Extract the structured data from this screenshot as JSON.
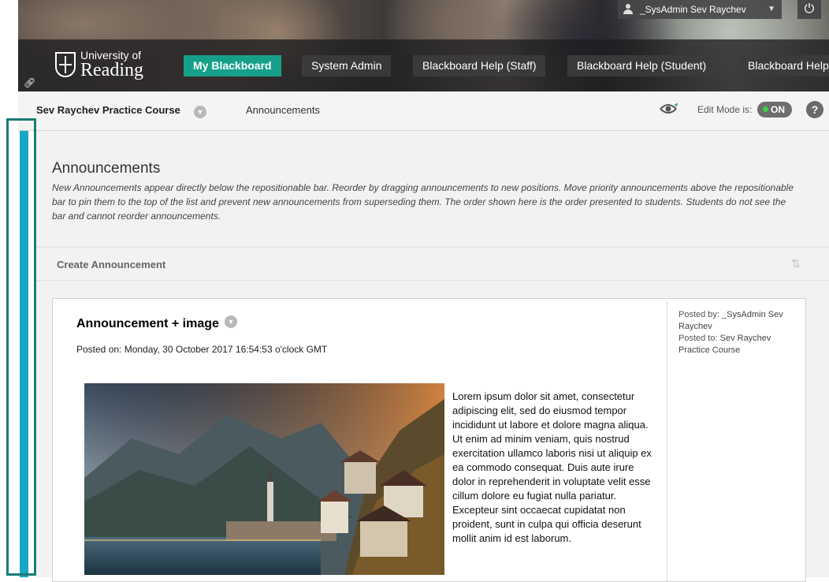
{
  "header": {
    "logo": {
      "line1": "University of",
      "line2": "Reading"
    },
    "tabs": [
      {
        "label": "My Blackboard",
        "active": true
      },
      {
        "label": "System Admin",
        "active": false
      },
      {
        "label": "Blackboard Help (Staff)",
        "active": false
      },
      {
        "label": "Blackboard Help (Student)",
        "active": false
      },
      {
        "label": "Blackboard Help",
        "active": false
      }
    ],
    "user": {
      "name": "_SysAdmin Sev Raychev"
    },
    "accent_color": "#17a089"
  },
  "breadcrumb": {
    "course": "Sev Raychev Practice Course",
    "page": "Announcements",
    "edit_mode_label": "Edit Mode is:",
    "edit_mode_state": "ON",
    "help_label": "?"
  },
  "main": {
    "title": "Announcements",
    "description": "New Announcements appear directly below the repositionable bar. Reorder by dragging announcements to new positions. Move priority announcements above the repositionable bar to pin them to the top of the list and prevent new announcements from superseding them. The order shown here is the order presented to students. Students do not see the bar and cannot reorder announcements.",
    "create_button": "Create Announcement",
    "announcement": {
      "title": "Announcement + image",
      "posted_on": "Posted on: Monday, 30 October 2017 16:54:53 o'clock GMT",
      "posted_by_label": "Posted by:",
      "posted_by": "_SysAdmin Sev Raychev",
      "posted_to_label": "Posted to:",
      "posted_to": "Sev Raychev Practice Course",
      "body": "Lorem ipsum dolor sit amet, consectetur adipiscing elit, sed do eiusmod tempor incididunt ut labore et dolore magna aliqua. Ut enim ad minim veniam, quis nostrud exercitation ullamco laboris nisi ut aliquip ex ea commodo consequat. Duis aute irure dolor in reprehenderit in voluptate velit esse cillum dolore eu fugiat nulla pariatur. Excepteur sint occaecat cupidatat non proident, sunt in culpa qui officia deserunt mollit anim id est laborum."
    }
  }
}
